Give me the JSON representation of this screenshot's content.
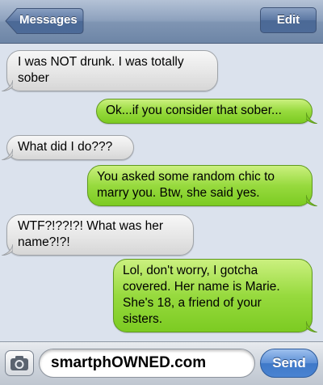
{
  "navbar": {
    "back_label": "Messages",
    "edit_label": "Edit"
  },
  "messages": [
    {
      "direction": "received",
      "lines": [
        "I was NOT drunk. I was totally",
        "sober"
      ]
    },
    {
      "direction": "sent",
      "lines": [
        "Ok...if you consider that sober..."
      ]
    },
    {
      "direction": "received",
      "lines": [
        "What did I do???"
      ]
    },
    {
      "direction": "sent",
      "lines": [
        "You asked some random chic to",
        "marry you. Btw, she said yes."
      ]
    },
    {
      "direction": "received",
      "lines": [
        "WTF?!??!?! What was her",
        "name?!?!"
      ]
    },
    {
      "direction": "sent",
      "lines": [
        "Lol, don't worry, I gotcha",
        "covered. Her name is Marie.",
        "She's 18, a friend of your",
        "sisters."
      ]
    }
  ],
  "input": {
    "value": "smartphOWNED.com",
    "send_label": "Send",
    "camera_icon": "camera-icon"
  },
  "colors": {
    "navbar": "#8da1bd",
    "sent_bubble": "#97da3e",
    "received_bubble": "#e6e6e6",
    "background": "#dbe2ed",
    "send_button": "#4a84d2"
  }
}
